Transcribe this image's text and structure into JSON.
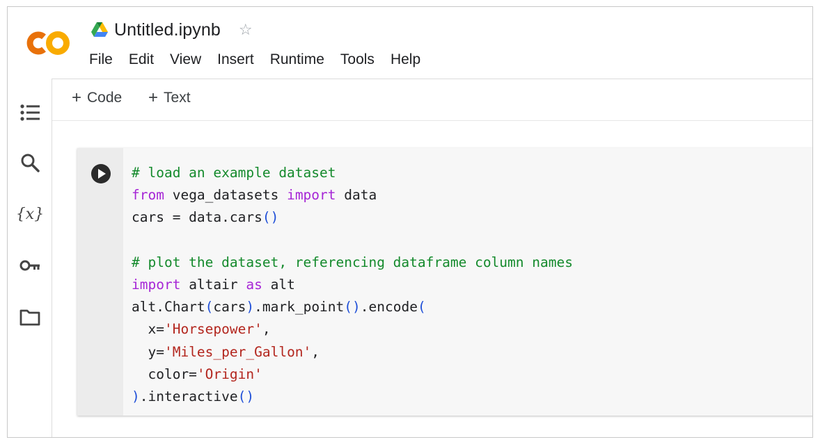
{
  "app": {
    "logo_text": "CO",
    "doc_title": "Untitled.ipynb",
    "brand_colors": {
      "logo_orange": "#F9AB00",
      "logo_dark_orange": "#E8710A"
    }
  },
  "menu": {
    "items": [
      "File",
      "Edit",
      "View",
      "Insert",
      "Runtime",
      "Tools",
      "Help"
    ]
  },
  "toolbar": {
    "add_code_label": "Code",
    "add_text_label": "Text",
    "plus_symbol": "+"
  },
  "sidebar": {
    "icons": [
      "table-of-contents-icon",
      "search-icon",
      "variables-icon",
      "secrets-key-icon",
      "files-folder-icon"
    ],
    "variables_glyph": "{x}"
  },
  "cell": {
    "code_lines": [
      [
        {
          "t": "# load an example dataset",
          "c": "cm"
        }
      ],
      [
        {
          "t": "from",
          "c": "kw"
        },
        {
          "t": " vega_datasets ",
          "c": ""
        },
        {
          "t": "import",
          "c": "kw"
        },
        {
          "t": " data",
          "c": ""
        }
      ],
      [
        {
          "t": "cars = data.cars",
          "c": ""
        },
        {
          "t": "()",
          "c": "pa"
        }
      ],
      [],
      [
        {
          "t": "# plot the dataset, referencing dataframe column names",
          "c": "cm"
        }
      ],
      [
        {
          "t": "import",
          "c": "kw"
        },
        {
          "t": " altair ",
          "c": ""
        },
        {
          "t": "as",
          "c": "kw"
        },
        {
          "t": " alt",
          "c": ""
        }
      ],
      [
        {
          "t": "alt.Chart",
          "c": ""
        },
        {
          "t": "(",
          "c": "pa"
        },
        {
          "t": "cars",
          "c": ""
        },
        {
          "t": ")",
          "c": "pa"
        },
        {
          "t": ".mark_point",
          "c": ""
        },
        {
          "t": "()",
          "c": "pa"
        },
        {
          "t": ".encode",
          "c": ""
        },
        {
          "t": "(",
          "c": "pa"
        }
      ],
      [
        {
          "t": "  x=",
          "c": ""
        },
        {
          "t": "'Horsepower'",
          "c": "st"
        },
        {
          "t": ",",
          "c": ""
        }
      ],
      [
        {
          "t": "  y=",
          "c": ""
        },
        {
          "t": "'Miles_per_Gallon'",
          "c": "st"
        },
        {
          "t": ",",
          "c": ""
        }
      ],
      [
        {
          "t": "  color=",
          "c": ""
        },
        {
          "t": "'Origin'",
          "c": "st"
        }
      ],
      [
        {
          "t": ")",
          "c": "pa"
        },
        {
          "t": ".interactive",
          "c": ""
        },
        {
          "t": "()",
          "c": "pa"
        }
      ]
    ]
  }
}
